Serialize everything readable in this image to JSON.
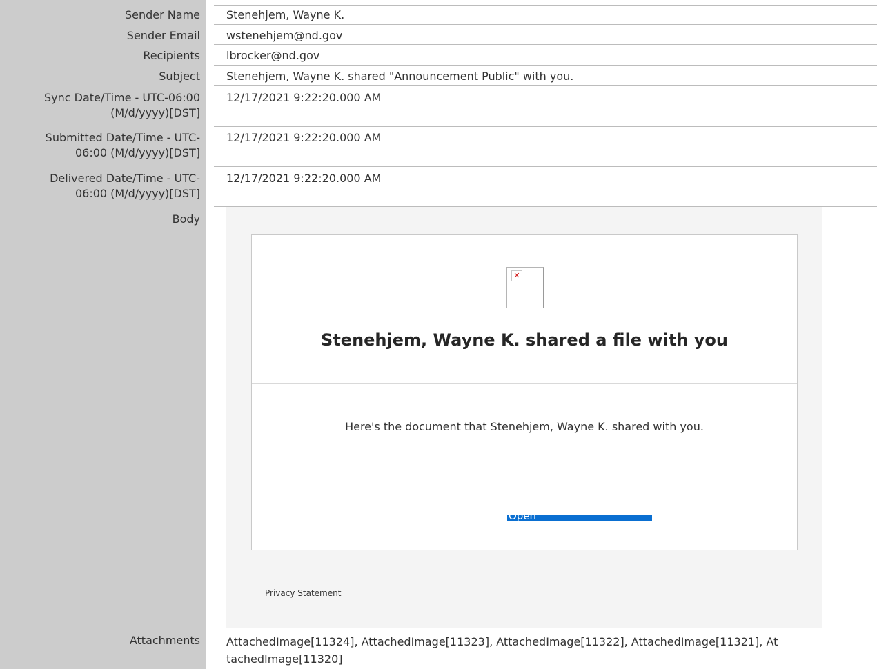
{
  "fields": {
    "sender_name_label": "Sender Name",
    "sender_name_value": "Stenehjem, Wayne K.",
    "sender_email_label": "Sender Email",
    "sender_email_value": "wstenehjem@nd.gov",
    "recipients_label": "Recipients",
    "recipients_value": "lbrocker@nd.gov",
    "subject_label": "Subject",
    "subject_value": "Stenehjem, Wayne K. shared \"Announcement Public\" with you.",
    "sync_label_line1": "Sync Date/Time - UTC-06:00",
    "sync_label_line2": "(M/d/yyyy)[DST]",
    "sync_value": "12/17/2021 9:22:20.000 AM",
    "submitted_label_line1": "Submitted Date/Time - UTC-",
    "submitted_label_line2": "06:00 (M/d/yyyy)[DST]",
    "submitted_value": "12/17/2021 9:22:20.000 AM",
    "delivered_label_line1": "Delivered Date/Time - UTC-",
    "delivered_label_line2": "06:00 (M/d/yyyy)[DST]",
    "delivered_value": "12/17/2021 9:22:20.000 AM",
    "body_label": "Body",
    "attachments_label": "Attachments",
    "attachments_value_line1": "AttachedImage[11324], AttachedImage[11323], AttachedImage[11322], AttachedImage[11321], At",
    "attachments_value_line2": "tachedImage[11320]"
  },
  "email_body": {
    "heading": "Stenehjem, Wayne K. shared a file with you",
    "message": "Here's the document that Stenehjem, Wayne K. shared with you.",
    "open_button": "Open",
    "privacy_link": "Privacy Statement",
    "broken_image_icon": "broken-image-icon"
  },
  "colors": {
    "label_column": "#cccccc",
    "open_button": "#0a6fd1",
    "broken_image_x": "#d42020"
  }
}
